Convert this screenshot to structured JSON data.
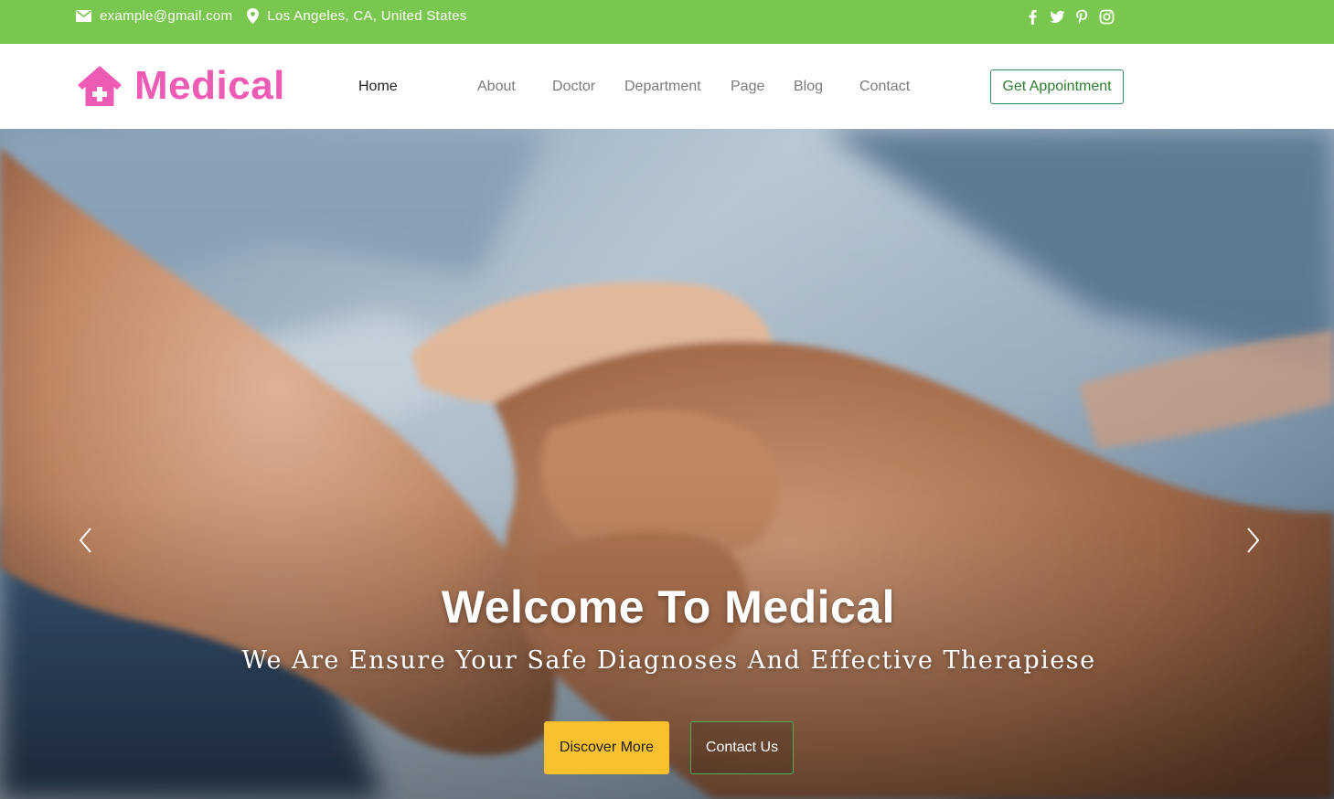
{
  "topbar": {
    "email": "example@gmail.com",
    "location": "Los Angeles, CA, United States",
    "social_icons": [
      "facebook-icon",
      "twitter-icon",
      "pinterest-icon",
      "instagram-icon"
    ],
    "background_color": "#7ac74f"
  },
  "header": {
    "logo_text": "Medical",
    "logo_color": "#ee5bb4",
    "nav": [
      {
        "label": "Home",
        "active": true
      },
      {
        "label": "About",
        "active": false
      },
      {
        "label": "Doctor",
        "active": false
      },
      {
        "label": "Department",
        "active": false
      },
      {
        "label": "Page",
        "active": false
      },
      {
        "label": "Blog",
        "active": false
      },
      {
        "label": "Contact",
        "active": false
      }
    ],
    "cta_label": "Get Appointment"
  },
  "hero": {
    "title": "Welcome To Medical",
    "subtitle": "We Are Ensure Your Safe Diagnoses And Effective Therapiese",
    "primary_button": "Discover More",
    "secondary_button": "Contact Us",
    "primary_button_color": "#fbc02d",
    "image_subject": "two hands clasped",
    "prev_icon": "chevron-left-icon",
    "next_icon": "chevron-right-icon"
  }
}
